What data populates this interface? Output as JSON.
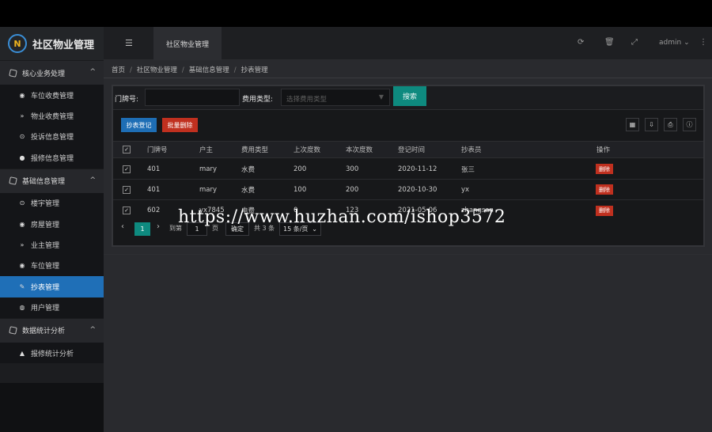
{
  "header": {
    "app_title": "社区物业管理",
    "logo_letters": "N",
    "active_tab": "社区物业管理",
    "user": "admin"
  },
  "sidebar": {
    "groups": [
      {
        "label": "核心业务处理",
        "items": [
          {
            "label": "车位收费管理",
            "icon": "dashboard-icon"
          },
          {
            "label": "物业收费管理",
            "icon": "chevron-double-down-icon"
          },
          {
            "label": "投诉信息管理",
            "icon": "target-icon"
          },
          {
            "label": "报修信息管理",
            "icon": "circle-icon"
          }
        ]
      },
      {
        "label": "基础信息管理",
        "items": [
          {
            "label": "楼宇管理",
            "icon": "target-icon"
          },
          {
            "label": "房屋管理",
            "icon": "dashboard-icon"
          },
          {
            "label": "业主管理",
            "icon": "chevron-double-down-icon"
          },
          {
            "label": "车位管理",
            "icon": "dashboard-icon"
          },
          {
            "label": "抄表管理",
            "icon": "edit-icon"
          },
          {
            "label": "用户管理",
            "icon": "user-icon"
          }
        ]
      },
      {
        "label": "数据统计分析",
        "items": [
          {
            "label": "报修统计分析",
            "icon": "area-chart-icon"
          }
        ]
      }
    ]
  },
  "breadcrumb": [
    "首页",
    "社区物业管理",
    "基础信息管理",
    "抄表管理"
  ],
  "search": {
    "door_label": "门牌号:",
    "door_value": "",
    "fee_label": "费用类型:",
    "fee_placeholder": "选择费用类型",
    "search_button": "搜索"
  },
  "toolbar": {
    "register_button": "抄表登记",
    "batch_delete_button": "批量删除"
  },
  "table": {
    "columns": [
      "门牌号",
      "户主",
      "费用类型",
      "上次度数",
      "本次度数",
      "登记时间",
      "抄表员",
      "操作"
    ],
    "rows": [
      {
        "door": "401",
        "owner": "mary",
        "type": "水费",
        "last": "200",
        "current": "300",
        "date": "2020-11-12",
        "reader": "张三",
        "action": "删除",
        "checked": true
      },
      {
        "door": "401",
        "owner": "mary",
        "type": "水费",
        "last": "100",
        "current": "200",
        "date": "2020-10-30",
        "reader": "yx",
        "action": "删除",
        "checked": true
      },
      {
        "door": "602",
        "owner": "yx7845",
        "type": "电费",
        "last": "0",
        "current": "123",
        "date": "2021-05-06",
        "reader": "zhangsan",
        "action": "删除",
        "checked": true
      }
    ]
  },
  "pager": {
    "current_page": "1",
    "goto_label": "到第",
    "goto_value": "1",
    "page_unit": "页",
    "confirm": "确定",
    "total": "共 3 条",
    "page_size": "15 条/页"
  },
  "watermark": "https://www.huzhan.com/ishop3572",
  "colors": {
    "accent": "#1f6fb7",
    "teal": "#0e8a7f",
    "danger": "#c0301f"
  }
}
